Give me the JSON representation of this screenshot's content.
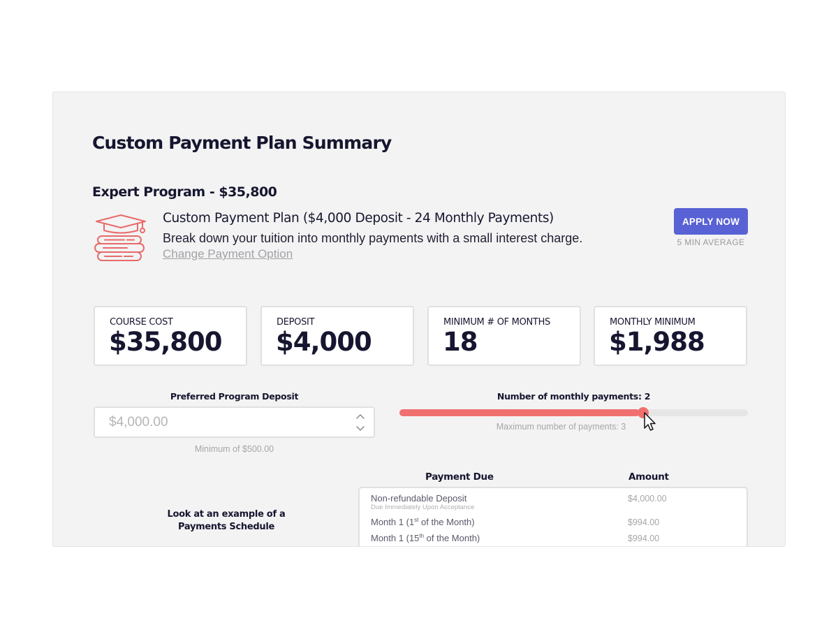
{
  "page": {
    "title": "Custom Payment Plan Summary",
    "program": "Expert Program - $35,800"
  },
  "plan": {
    "icon": "graduation-books-icon",
    "title": "Custom Payment Plan ($4,000 Deposit - 24 Monthly Payments)",
    "description": "Break down your tuition into monthly payments with a small interest charge.",
    "change_link": "Change Payment Option",
    "apply_label": "APPLY NOW",
    "apply_sub": "5 MIN AVERAGE"
  },
  "stats": [
    {
      "label": "COURSE COST",
      "value": "$35,800"
    },
    {
      "label": "DEPOSIT",
      "value": "$4,000"
    },
    {
      "label": "MINIMUM # OF MONTHS",
      "value": "18"
    },
    {
      "label": "MONTHLY MINIMUM",
      "value": "$1,988"
    }
  ],
  "deposit": {
    "label": "Preferred Program Deposit",
    "placeholder": "$4,000.00",
    "hint": "Minimum of $500.00"
  },
  "payments": {
    "label": "Number of monthly payments: 2",
    "hint": "Maximum number of payments: 3",
    "slider_fraction": 0.689
  },
  "schedule": {
    "example_line1": "Look at an example of a",
    "example_line2": "Payments Schedule",
    "col_due": "Payment Due",
    "col_amount": "Amount",
    "rows": [
      {
        "label": "Non-refundable Deposit",
        "sub": "Due Immediately Upon Acceptance",
        "amount": "$4,000.00"
      },
      {
        "label_pre": "Month 1 (1",
        "label_sup": "st",
        "label_post": " of the Month)",
        "amount": "$994.00"
      },
      {
        "label_pre": "Month 1 (15",
        "label_sup": "th",
        "label_post": " of the Month)",
        "amount": "$994.00"
      }
    ]
  },
  "colors": {
    "accent": "#5862d4",
    "slider": "#f07070",
    "icon": "#e86a6a",
    "panel_bg": "#f3f3f3"
  }
}
